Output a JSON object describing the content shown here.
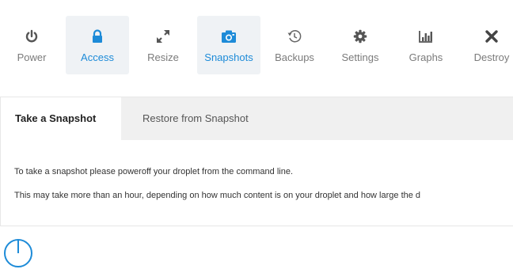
{
  "toolbar": {
    "items": [
      {
        "label": "Power",
        "icon": "power-icon"
      },
      {
        "label": "Access",
        "icon": "lock-icon"
      },
      {
        "label": "Resize",
        "icon": "resize-icon"
      },
      {
        "label": "Snapshots",
        "icon": "camera-icon"
      },
      {
        "label": "Backups",
        "icon": "history-icon"
      },
      {
        "label": "Settings",
        "icon": "gear-icon"
      },
      {
        "label": "Graphs",
        "icon": "bar-chart-icon"
      },
      {
        "label": "Destroy",
        "icon": "close-icon"
      }
    ],
    "active": [
      "Access",
      "Snapshots"
    ]
  },
  "tabs": {
    "selected": "Take a Snapshot",
    "other": "Restore from Snapshot"
  },
  "content": {
    "line1": "To take a snapshot please poweroff your droplet from the command line.",
    "line2": "This may take more than an hour, depending on how much content is on your droplet and how large the d"
  },
  "colors": {
    "accent": "#1d8bd8",
    "icon_gray": "#555555",
    "active_bg": "#eff2f5",
    "tabbar_bg": "#f0f0f0"
  }
}
